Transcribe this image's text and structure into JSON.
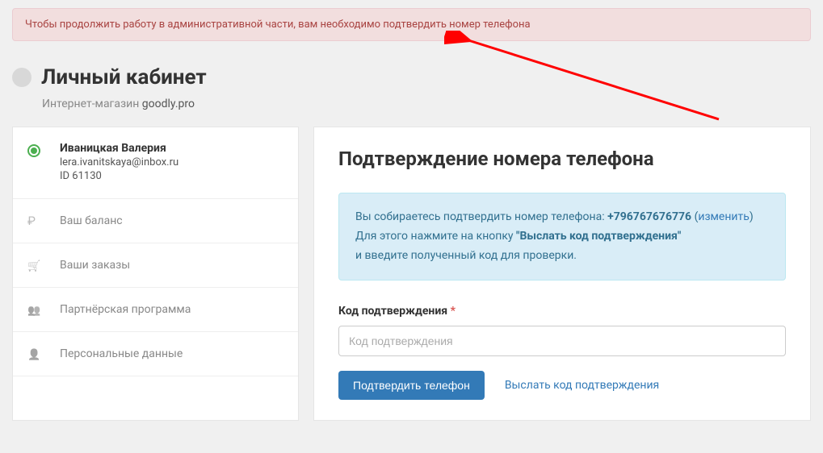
{
  "alert": {
    "text": "Чтобы продолжить работу в административной части, вам необходимо подтвердить номер телефона"
  },
  "header": {
    "title": "Личный кабинет",
    "subtitle_prefix": "Интернет-магазин ",
    "shop_name": "goodly.pro"
  },
  "sidebar": {
    "user": {
      "name": "Иваницкая Валерия",
      "email": "lera.ivanitskaya@inbox.ru",
      "id_label": "ID 61130"
    },
    "items": [
      {
        "icon": "ruble-icon",
        "label": "Ваш баланс"
      },
      {
        "icon": "cart-icon",
        "label": "Ваши заказы"
      },
      {
        "icon": "users-icon",
        "label": "Партнёрская программа"
      },
      {
        "icon": "person-icon",
        "label": "Персональные данные"
      }
    ]
  },
  "main": {
    "title": "Подтверждение номера телефона",
    "info": {
      "line1_prefix": "Вы собираетесь подтвердить номер телефона: ",
      "phone": "+796767676776",
      "change_label": "изменить",
      "line2_prefix": "Для этого нажмите на кнопку ",
      "line2_bold": "\"Выслать код подтверждения\"",
      "line3": "и введите полученный код для проверки."
    },
    "form": {
      "label": "Код подтверждения",
      "required_mark": "*",
      "placeholder": "Код подтверждения",
      "submit_label": "Подтвердить телефон",
      "send_link_label": "Выслать код подтверждения"
    }
  }
}
